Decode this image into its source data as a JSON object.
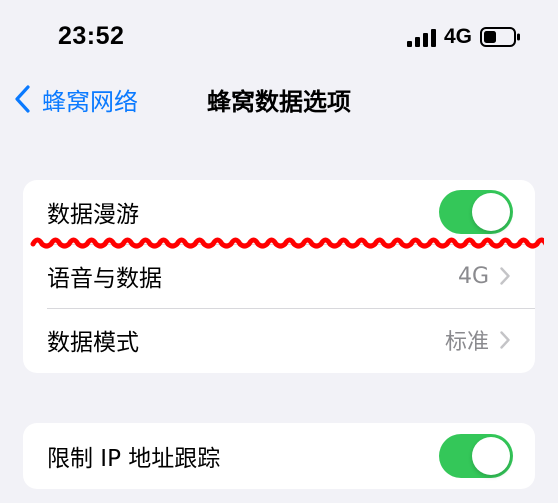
{
  "status_bar": {
    "time": "23:52",
    "network": "4G",
    "signal_icon": "cellular-signal-icon",
    "battery_icon": "battery-icon",
    "battery_level": 0.3
  },
  "nav": {
    "back_label": "蜂窝网络",
    "back_icon": "chevron-left-icon",
    "title": "蜂窝数据选项"
  },
  "groups": [
    {
      "rows": [
        {
          "label": "数据漫游",
          "control": "toggle",
          "on": true
        },
        {
          "label": "语音与数据",
          "value": "4G",
          "control": "disclosure"
        },
        {
          "label": "数据模式",
          "value": "标准",
          "control": "disclosure"
        }
      ]
    },
    {
      "rows": [
        {
          "label": "限制 IP 地址跟踪",
          "control": "toggle",
          "on": true
        }
      ]
    }
  ],
  "colors": {
    "accent": "#0a7aff",
    "toggle_on": "#34c759",
    "background": "#f2f2f7",
    "secondary_text": "#8a8a8e",
    "annotation_red": "#ff0000"
  }
}
